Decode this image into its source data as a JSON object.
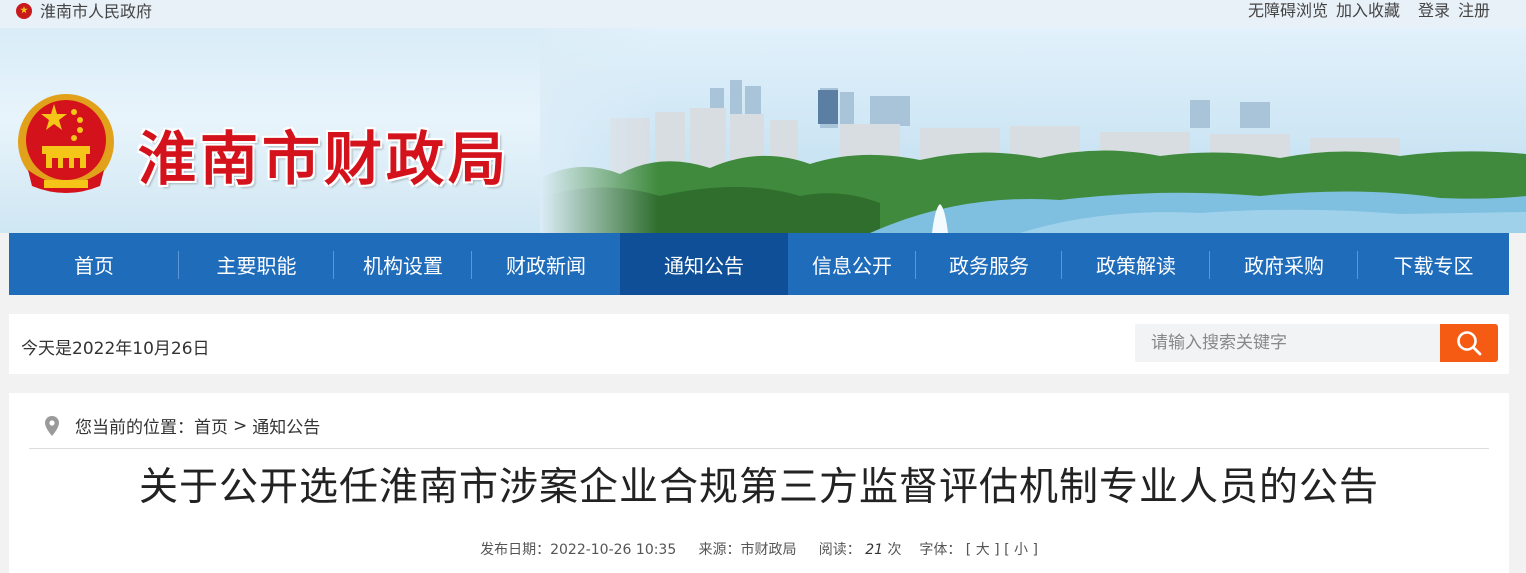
{
  "topbar": {
    "gov_link": "淮南市人民政府",
    "accessibility": "无障碍浏览",
    "bookmark": "加入收藏",
    "login": "登录",
    "register": "注册"
  },
  "header": {
    "site_title": "淮南市财政局"
  },
  "nav": {
    "items": [
      {
        "label": "首页"
      },
      {
        "label": "主要职能"
      },
      {
        "label": "机构设置"
      },
      {
        "label": "财政新闻"
      },
      {
        "label": "通知公告"
      },
      {
        "label": "信息公开"
      },
      {
        "label": "政务服务"
      },
      {
        "label": "政策解读"
      },
      {
        "label": "政府采购"
      },
      {
        "label": "下载专区"
      }
    ],
    "active_index": 4
  },
  "infobar": {
    "date_text": "今天是2022年10月26日",
    "search_placeholder": "请输入搜索关键字"
  },
  "breadcrumb": {
    "prefix": "您当前的位置：",
    "home": "首页",
    "separator": ">",
    "current": "通知公告"
  },
  "article": {
    "title": "关于公开选任淮南市涉案企业合规第三方监督评估机制专业人员的公告",
    "date_label": "发布日期：",
    "date": "2022-10-26 10:35",
    "source_label": "来源：",
    "source": "市财政局",
    "views_label": "阅读：",
    "views": "21",
    "views_unit": "次",
    "font_label": "字体：",
    "font_large": "[ 大 ]",
    "font_small": "[ 小 ]"
  },
  "colors": {
    "nav_bg": "#1f6cbb",
    "nav_active": "#0f4f97",
    "search_button": "#f55b13",
    "title_red": "#d4121c"
  }
}
